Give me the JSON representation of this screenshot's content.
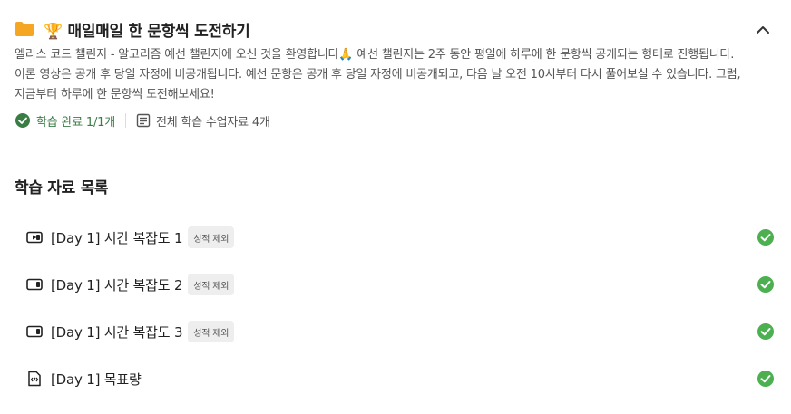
{
  "header": {
    "folder_icon": "folder-icon",
    "trophy_emoji": "🏆",
    "title_text": "매일매일 한 문항씩 도전하기",
    "collapse_icon": "chevron-up-icon"
  },
  "description": {
    "line1_part1": "엘리스 코드 챌린지 - 알고리즘 예선 챌린지에 오신 것을 환영합니다",
    "line1_emoji": "🙏",
    "line1_part2": " 예선 챌린지는 2주 동안 평일에 하루에 한 문항씩 공개되는 형태로 진행됩니다.",
    "line2": "이론 영상은 공개 후 당일 자정에 비공개됩니다. 예선 문항은 공개 후 당일 자정에 비공개되고, 다음 날 오전 10시부터 다시 풀어보실 수 있습니다. 그럼,",
    "line3": "지금부터 하루에 한 문항씩 도전해보세요!"
  },
  "meta": {
    "complete_label": "학습 완료 1/1개",
    "total_label": "전체 학습 수업자료 4개",
    "complete_color": "#3a7d44"
  },
  "section": {
    "title": "학습 자료 목록"
  },
  "items": [
    {
      "label": "[Day 1] 시간 복잡도 1",
      "badge": "성적 제외",
      "type": "video-icon",
      "completed": true
    },
    {
      "label": "[Day 1] 시간 복잡도 2",
      "badge": "성적 제외",
      "type": "video-icon",
      "completed": true
    },
    {
      "label": "[Day 1] 시간 복잡도 3",
      "badge": "성적 제외",
      "type": "video-icon",
      "completed": true
    },
    {
      "label": "[Day 1] 목표량",
      "badge": "",
      "type": "code-file-icon",
      "completed": true
    }
  ],
  "colors": {
    "folder": "#f5a623",
    "check": "#4caf50",
    "badge_bg": "#eeeeee"
  }
}
